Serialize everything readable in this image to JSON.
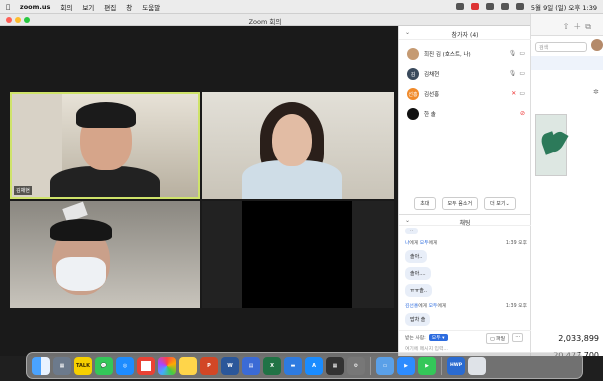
{
  "menubar": {
    "app": "zoom.us",
    "items": [
      "회의",
      "보기",
      "편집",
      "창",
      "도움말"
    ],
    "clock": "5월 9일 (일) 오후 1:39"
  },
  "zoom": {
    "title": "Zoom 회의",
    "tiles": [
      {
        "name": "김채현"
      }
    ],
    "participants_title": "참가자 (4)",
    "participants": [
      {
        "name": "희진 김 (호스트, 나)",
        "avatar_text": "",
        "avatar_color": "#c59a72",
        "mic": "on",
        "video": "on"
      },
      {
        "name": "김채현",
        "avatar_text": "김",
        "avatar_color": "#3a4a5c",
        "mic": "on",
        "video": "on"
      },
      {
        "name": "김선홍",
        "avatar_text": "선홍",
        "avatar_color": "#f08a2a",
        "mic": "muted",
        "video": "on"
      },
      {
        "name": "한 솔",
        "avatar_text": "",
        "avatar_color": "#111111",
        "mic": "",
        "video": "off"
      }
    ],
    "buttons": {
      "invite": "초대",
      "mute_all": "모두 음소거",
      "more": "더 보기"
    },
    "chat_title": "채팅",
    "chat": {
      "group1_from": "나",
      "group1_to": "모두",
      "group1_suffix": "에게",
      "group1_time": "1:39 오후",
      "msgs1": [
        "솔아..",
        "솔아....",
        "ㅠㅠ솔.."
      ],
      "group2_from": "김선홍",
      "group2_to": "모두",
      "group2_suffix": "에게",
      "group2_time": "1:39 오후",
      "msgs2": [
        "밥차 솔"
      ],
      "to_label": "받는 사람:",
      "to_value": "모두",
      "file_btn": "파일",
      "more_btn": "···",
      "input_placeholder": "여기에 메시지 입력..."
    }
  },
  "background_window": {
    "search_placeholder": "검색",
    "value1": "2,033,899",
    "value2": "20,477,700"
  },
  "dock": {
    "icons": [
      "finder-icon",
      "launchpad-icon",
      "kakaotalk-icon",
      "messages-icon",
      "safari-icon",
      "chrome-icon",
      "photos-icon",
      "notes-icon",
      "powerpoint-icon",
      "word-icon",
      "notion-icon",
      "excel-icon",
      "stocks-icon",
      "appstore-icon",
      "calculator-icon",
      "settings-icon",
      "preview-icon",
      "zoom-icon",
      "facetime-icon",
      "hwp-icon",
      "trash-icon"
    ],
    "kakaotalk_label": "TALK",
    "hwp_label": "HWP"
  }
}
